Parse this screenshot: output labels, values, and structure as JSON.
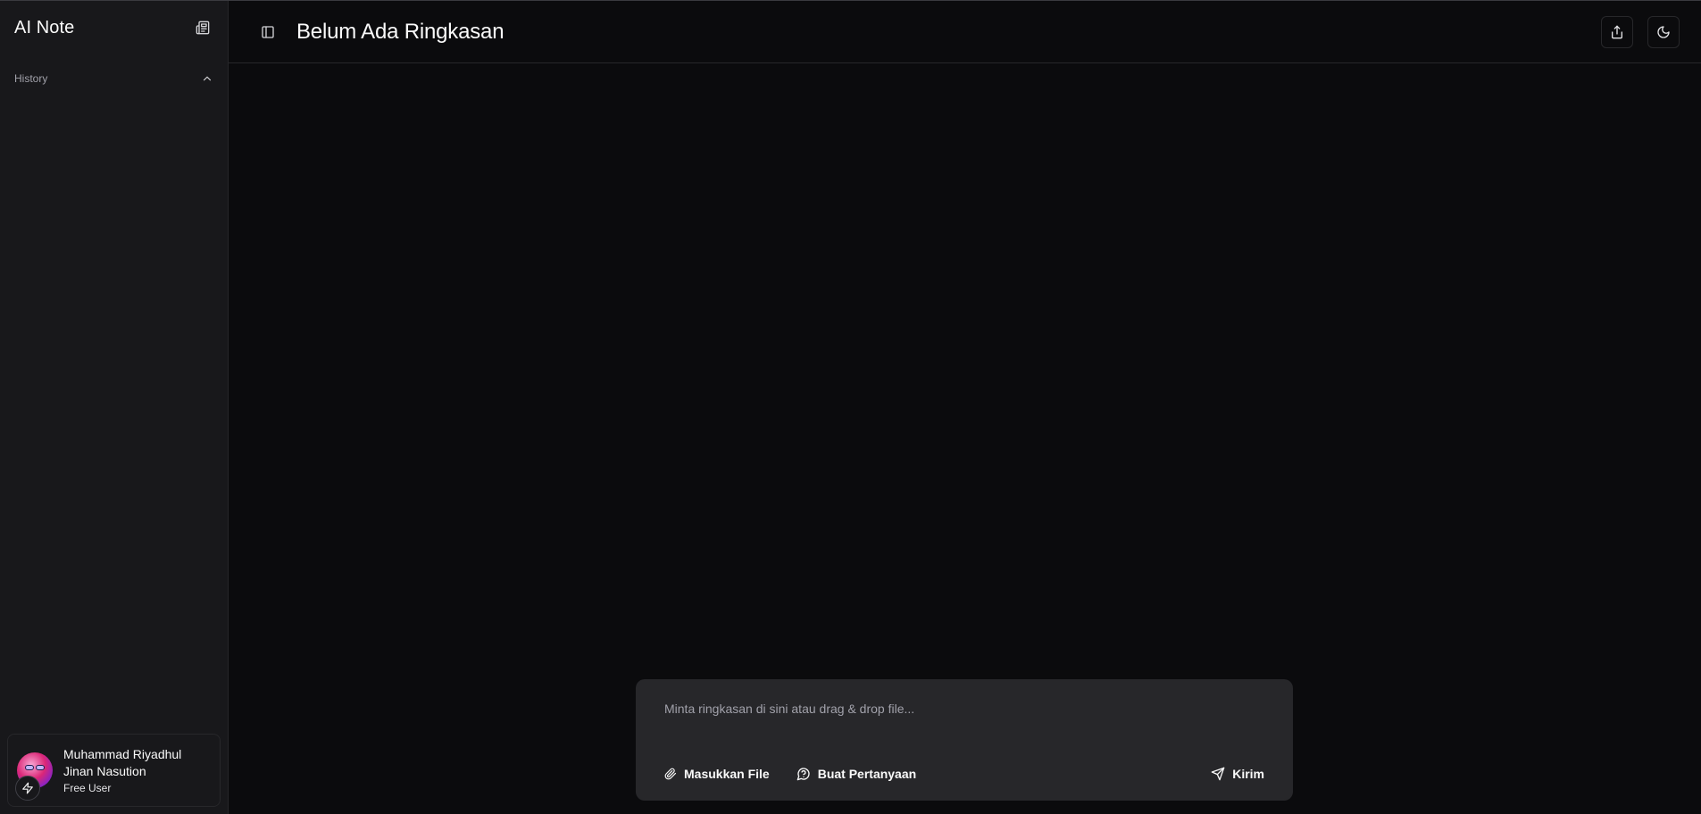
{
  "sidebar": {
    "app_title": "AI Note",
    "new_note_icon": "newspaper-icon",
    "history_label": "History",
    "history_toggle_icon": "chevron-up-icon",
    "user": {
      "name_line1": "Muhammad Riyadhul",
      "name_line2": "Jinan Nasution",
      "plan": "Free User"
    }
  },
  "header": {
    "title": "Belum Ada Ringkasan",
    "toggle_sidebar_icon": "panel-left-icon",
    "share_icon": "share-icon",
    "theme_icon": "moon-icon"
  },
  "composer": {
    "placeholder": "Minta ringkasan di sini atau drag & drop file...",
    "value": "",
    "attach_label": "Masukkan File",
    "question_label": "Buat Pertanyaan",
    "send_label": "Kirim"
  },
  "colors": {
    "background": "#0b0b0d",
    "sidebar": "#18181b",
    "composer": "#27272a",
    "border": "#27272a"
  }
}
